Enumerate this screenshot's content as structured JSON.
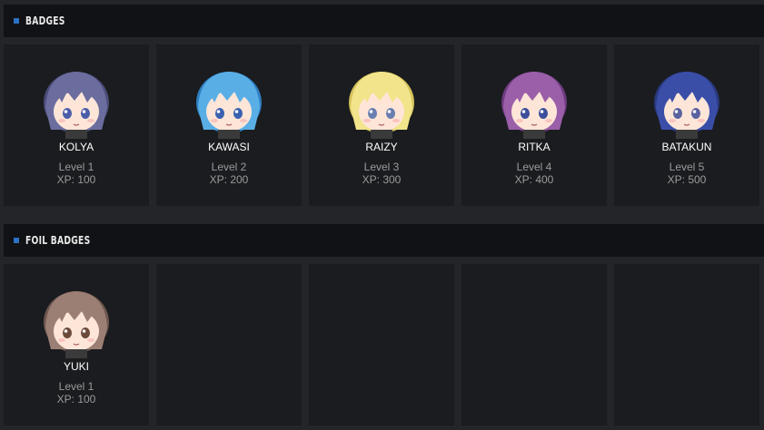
{
  "sections": {
    "badges": {
      "title": "BADGES",
      "items": [
        {
          "name": "KOLYA",
          "level": "Level 1",
          "xp": "XP: 100",
          "hair": "#6b6d9e",
          "hair_dark": "#4b4c78",
          "eyes": "#4a5ea8"
        },
        {
          "name": "KAWASI",
          "level": "Level 2",
          "xp": "XP: 200",
          "hair": "#5aaee6",
          "hair_dark": "#2f7fc0",
          "eyes": "#3b62b0"
        },
        {
          "name": "RAIZY",
          "level": "Level 3",
          "xp": "XP: 300",
          "hair": "#f1e48a",
          "hair_dark": "#d5c25a",
          "eyes": "#6a7fb0"
        },
        {
          "name": "RITKA",
          "level": "Level 4",
          "xp": "XP: 400",
          "hair": "#9a5fa8",
          "hair_dark": "#6e3c80",
          "eyes": "#3d4f9c"
        },
        {
          "name": "BATAKUN",
          "level": "Level 5",
          "xp": "XP: 500",
          "hair": "#3a4ea8",
          "hair_dark": "#2a387c",
          "eyes": "#5a62a0"
        }
      ]
    },
    "foil_badges": {
      "title": "FOIL BADGES",
      "items": [
        {
          "name": "YUKI",
          "level": "Level 1",
          "xp": "XP: 100",
          "hair": "#9c7f74",
          "hair_dark": "#6e574f",
          "eyes": "#6b4a3a"
        }
      ]
    }
  },
  "colors": {
    "background": "#232529",
    "card": "#1a1c1f",
    "header": "#111215",
    "accent": "#2c72c4"
  }
}
